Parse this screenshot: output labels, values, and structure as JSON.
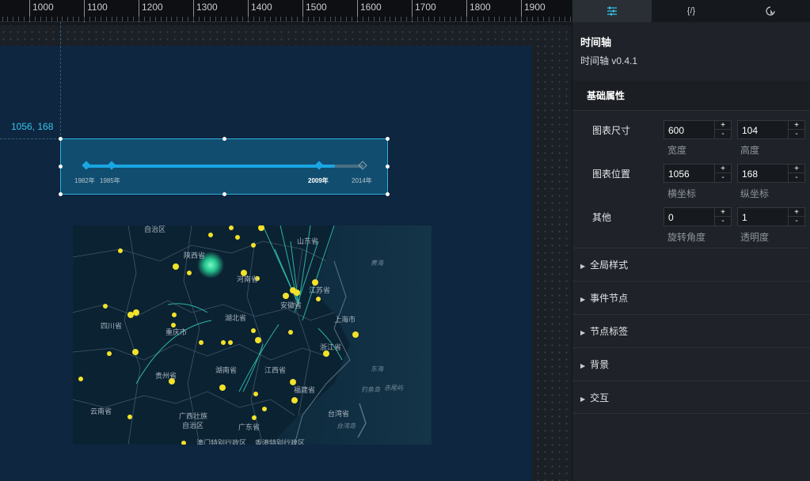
{
  "ruler": {
    "ticks": [
      "1000",
      "1100",
      "1200",
      "1300",
      "1400",
      "1500",
      "1600",
      "1700",
      "1800",
      "1900"
    ]
  },
  "canvas": {
    "coord_label": "1056, 168"
  },
  "timeline": {
    "labels": [
      "1982年",
      "1985年",
      "2009年",
      "2014年"
    ],
    "active_label": "2009年",
    "accent_color": "#1aa6e3"
  },
  "map": {
    "provinces": [
      "自治区",
      "陕西省",
      "山东省",
      "河南省",
      "江苏省",
      "安徽省",
      "四川省",
      "湖北省",
      "上海市",
      "重庆市",
      "浙江省",
      "贵州省",
      "湖南省",
      "江西省",
      "福建省",
      "云南省",
      "广西壮族",
      "自治区",
      "广东省",
      "台湾省",
      "澳门特别行政区",
      "香港特别行政区"
    ],
    "seas": [
      "黄海",
      "东海",
      "钓鱼岛",
      "赤尾屿",
      "台湾岛"
    ],
    "dot_color": "#f2e22a",
    "highlight_color": "#29d99a"
  },
  "panel": {
    "tabs": [
      {
        "name": "settings-tab",
        "label": "☰"
      },
      {
        "name": "data-tab",
        "label": "{/}"
      },
      {
        "name": "interaction-tab",
        "label": "⟳"
      }
    ],
    "component_name": "时间轴",
    "component_version": "时间轴 v0.4.1",
    "basic_section": "基础属性",
    "rows": [
      {
        "label": "图表尺寸",
        "a_value": "600",
        "a_sub": "宽度",
        "b_value": "104",
        "b_sub": "高度"
      },
      {
        "label": "图表位置",
        "a_value": "1056",
        "a_sub": "横坐标",
        "b_value": "168",
        "b_sub": "纵坐标"
      },
      {
        "label": "其他",
        "a_value": "0",
        "a_sub": "旋转角度",
        "b_value": "1",
        "b_sub": "透明度"
      }
    ],
    "collapsed_sections": [
      "全局样式",
      "事件节点",
      "节点标签",
      "背景",
      "交互"
    ],
    "stepper": {
      "up": "+",
      "down": "-"
    }
  }
}
